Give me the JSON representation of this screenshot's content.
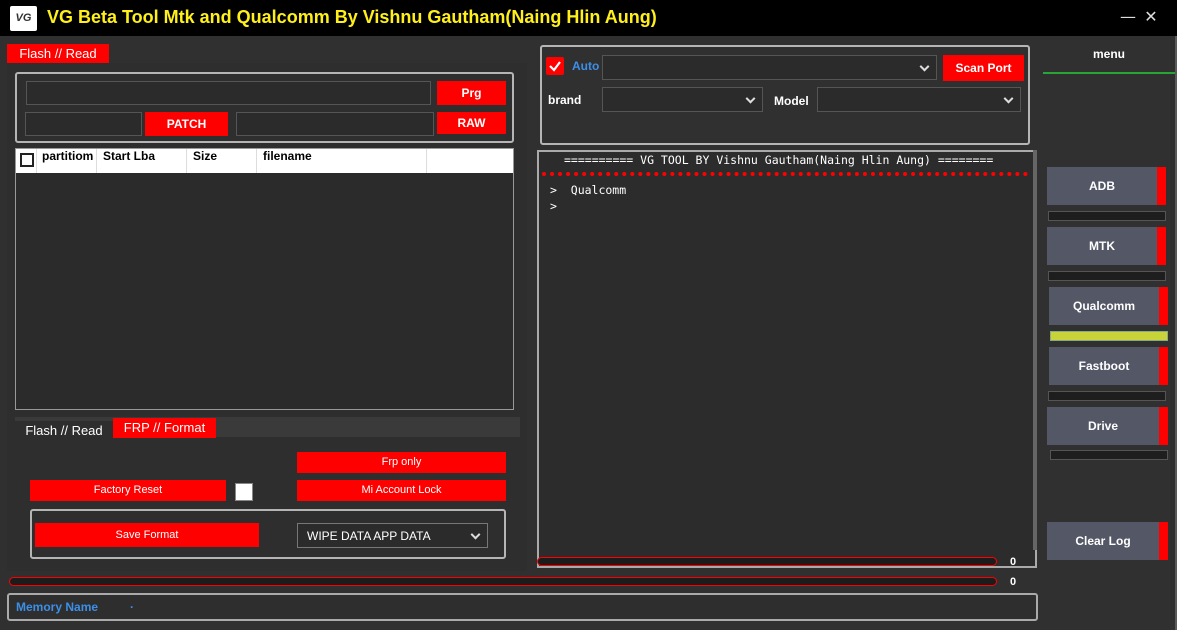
{
  "window": {
    "logo_text": "VG",
    "title": "VG Beta Tool Mtk and Qualcomm By Vishnu Gautham(Naing Hlin Aung)",
    "minimize_glyph": "—",
    "close_glyph": "✕"
  },
  "left": {
    "tab_label": "Flash // Read",
    "buttons": {
      "prg": "Prg",
      "patch": "PATCH",
      "raw": "RAW"
    },
    "table": {
      "columns": [
        "partitiom",
        "Start Lba",
        "Size",
        "filename"
      ]
    },
    "subtabs": [
      "Flash // Read",
      "FRP // Format"
    ],
    "frp": {
      "frp_only": "Frp only",
      "factory_reset": "Factory Reset",
      "mi_account_lock": "Mi Account Lock",
      "save_format": "Save Format",
      "wipe_select": "WIPE DATA APP DATA"
    }
  },
  "connection": {
    "auto_label": "Auto",
    "auto_checked": true,
    "scan_port": "Scan Port",
    "brand_label": "brand",
    "model_label": "Model"
  },
  "log": {
    "header": "========== VG TOOL BY Vishnu Gautham(Naing Hlin Aung) ========",
    "lines": [
      ">  Qualcomm",
      ">"
    ],
    "progress_value": "0"
  },
  "bottom": {
    "progress_value": "0",
    "memory_label": "Memory Name",
    "memory_value": "."
  },
  "menu": {
    "header": "menu",
    "items": [
      "ADB",
      "MTK",
      "Qualcomm",
      "Fastboot",
      "Drive"
    ],
    "active_item": "Qualcomm",
    "clear_log": "Clear Log"
  },
  "colors": {
    "accent_red": "#ff0000",
    "title_yellow": "#ffef1a",
    "menu_green": "#27a635",
    "active_bar": "#c8d33a",
    "memory_blue": "#3c8fe8"
  }
}
